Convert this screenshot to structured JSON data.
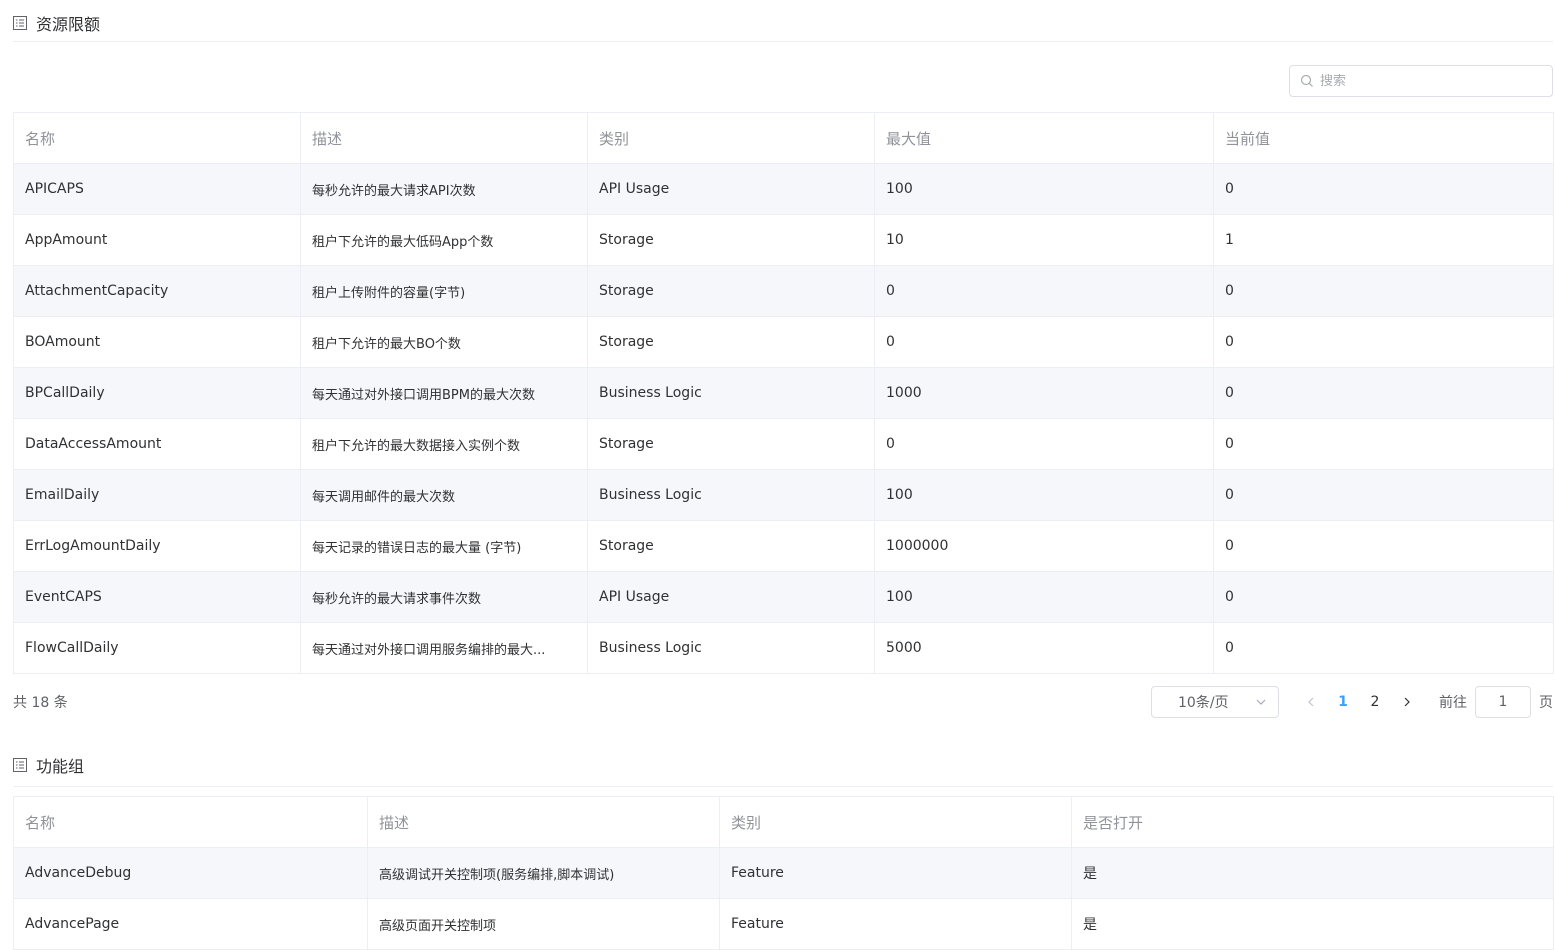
{
  "quota_section": {
    "title": "资源限额",
    "search_placeholder": "搜索",
    "columns": [
      "名称",
      "描述",
      "类别",
      "最大值",
      "当前值"
    ],
    "rows": [
      [
        "APICAPS",
        "每秒允许的最大请求API次数",
        "API Usage",
        "100",
        "0"
      ],
      [
        "AppAmount",
        "租户下允许的最大低码App个数",
        "Storage",
        "10",
        "1"
      ],
      [
        "AttachmentCapacity",
        "租户上传附件的容量(字节)",
        "Storage",
        "0",
        "0"
      ],
      [
        "BOAmount",
        "租户下允许的最大BO个数",
        "Storage",
        "0",
        "0"
      ],
      [
        "BPCallDaily",
        "每天通过对外接口调用BPM的最大次数",
        "Business Logic",
        "1000",
        "0"
      ],
      [
        "DataAccessAmount",
        "租户下允许的最大数据接入实例个数",
        "Storage",
        "0",
        "0"
      ],
      [
        "EmailDaily",
        "每天调用邮件的最大次数",
        "Business Logic",
        "100",
        "0"
      ],
      [
        "ErrLogAmountDaily",
        "每天记录的错误日志的最大量 (字节)",
        "Storage",
        "1000000",
        "0"
      ],
      [
        "EventCAPS",
        "每秒允许的最大请求事件次数",
        "API Usage",
        "100",
        "0"
      ],
      [
        "FlowCallDaily",
        "每天通过对外接口调用服务编排的最大...",
        "Business Logic",
        "5000",
        "0"
      ]
    ]
  },
  "pagination": {
    "total_text": "共 18 条",
    "page_size": "10条/页",
    "pages": [
      "1",
      "2"
    ],
    "current_page": "1",
    "goto_label": "前往",
    "goto_value": "1",
    "page_suffix": "页"
  },
  "feature_section": {
    "title": "功能组",
    "columns": [
      "名称",
      "描述",
      "类别",
      "是否打开"
    ],
    "rows": [
      [
        "AdvanceDebug",
        "高级调试开关控制项(服务编排,脚本调试)",
        "Feature",
        "是"
      ],
      [
        "AdvancePage",
        "高级页面开关控制项",
        "Feature",
        "是"
      ]
    ]
  },
  "colors": {
    "header_text": "#909399",
    "active_page": "#409eff",
    "stripe": "#f5f7fa",
    "border": "#ebeef5"
  },
  "icons": {
    "section": "list-icon",
    "search": "search-icon",
    "dropdown": "chevron-down-icon",
    "prev": "chevron-left-icon",
    "next": "chevron-right-icon"
  }
}
